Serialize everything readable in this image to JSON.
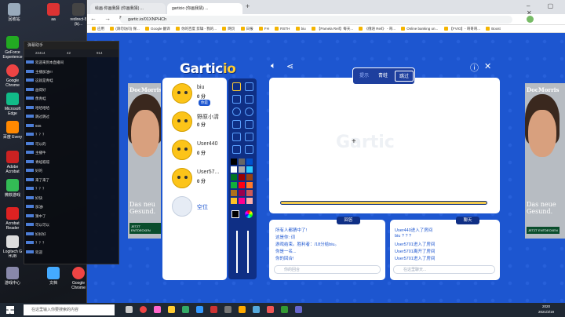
{
  "desktop": {
    "icons": [
      "回收站",
      "aa",
      "redirect-5 (b)...",
      "GeForce Experience",
      "Google Chrome",
      "Microsoft Edge",
      "百度 Every",
      "Adobe Acrobat",
      "微软游戏",
      "Acrobat Reader",
      "Logitech G HUB",
      "游戏中心",
      "文档",
      "Google Chrome"
    ]
  },
  "browser": {
    "tabs": [
      "绘画·你画我猜 (你画我猜) ...",
      "garticio (你画我猜) ..."
    ],
    "url": "gartic.io/01XNPHCh",
    "bookmarks": [
      "应用",
      "(请勿访问) 保... ",
      "Google 翻译",
      "你的百度 剪辑 - 我的...",
      "网页",
      "日报",
      "FH",
      "RSTH",
      "biu",
      "【Pamela Reif】每天...",
      "《俄语 Reif》 - 哥...",
      "Online banking un...",
      "【FVIO】- 哥哥哥...",
      "Boost"
    ]
  },
  "game": {
    "logo_main": "Gartic",
    "logo_suffix": "io",
    "word_bar": {
      "left": "提示",
      "middle": "青蛙",
      "right": "跳过"
    },
    "players": [
      {
        "name": "biu",
        "score": "0 分",
        "badge": "你是"
      },
      {
        "name": "野原小清",
        "score": "0 分"
      },
      {
        "name": "User440",
        "score": "0 分"
      },
      {
        "name": "User57...",
        "score": "0 分"
      },
      {
        "name": "空位",
        "empty": true
      }
    ],
    "answers_header": "回答",
    "chat_header": "聊天",
    "answers_lines": [
      "所有人都猜中了!",
      "这是你: 词",
      "游戏结束。胜利者：/18分给biu。",
      "你是一名...",
      "你的回合!"
    ],
    "chat_lines": [
      "User440进入了房间",
      "biu ? ? ?",
      "User5701进入了房间",
      "User5701离开了房间",
      "User5701进入了房间"
    ],
    "answers_placeholder": "你的回合",
    "chat_placeholder": "在这里聊天...",
    "colors": [
      "#000000",
      "#666666",
      "#0050cd",
      "#ffffff",
      "#aaaaaa",
      "#26c9ff",
      "#017420",
      "#990000",
      "#964112",
      "#11b03c",
      "#ff0013",
      "#ff7829",
      "#b0701c",
      "#99004e",
      "#cb5a57",
      "#ffc126",
      "#ff008f",
      "#feafa8"
    ]
  },
  "ads": {
    "brand": "DocMorris",
    "text_left": "Das neu Gesund.",
    "text_right": "Das neue Gesund.",
    "cta": "JETZT ENTDECKEN"
  },
  "overlay": {
    "title": "弹幕助手",
    "stats": [
      "22414",
      "42",
      "914"
    ],
    "lines": [
      "欢迎来到本直播间",
      "主播加油!!!",
      "这就是青蛙",
      "画得好",
      "像青蛙",
      "哈哈哈哈",
      "跳过跳过",
      "666",
      "？？？",
      "可以的",
      "主播牛",
      "青蛙呱呱",
      "好的",
      "来了来了",
      "？？？",
      "好快",
      "加油!",
      "猜中了",
      "可以可以",
      "好好好",
      "？？？",
      "欢迎"
    ]
  },
  "taskbar": {
    "search_placeholder": "在这里输入你要搜索的内容",
    "time": "2020",
    "date": "2021/3/19"
  }
}
